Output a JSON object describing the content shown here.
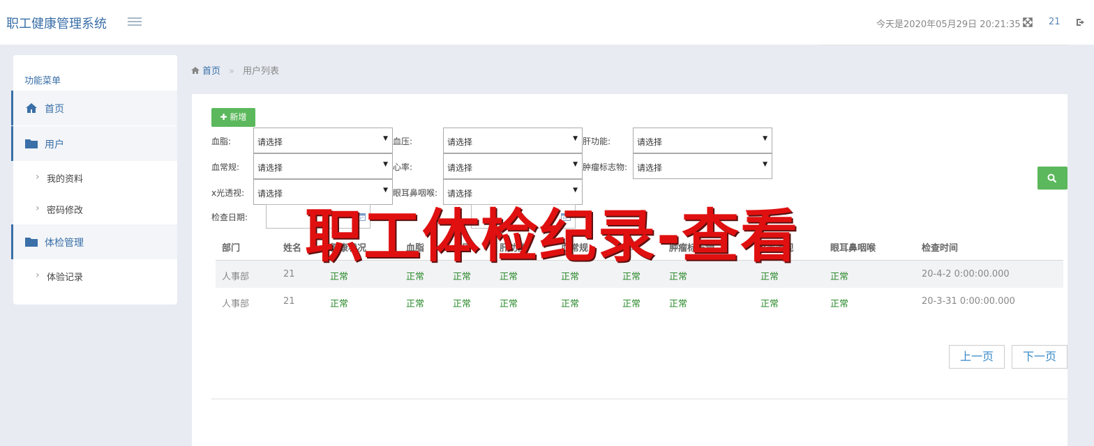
{
  "header": {
    "app_title": "职工健康管理系统",
    "datetime": "今天是2020年05月29日 20:21:35",
    "user": "21"
  },
  "sidebar": {
    "heading": "功能菜单",
    "items": [
      {
        "label": "首页",
        "icon": "home-icon"
      },
      {
        "label": "用户",
        "icon": "folder-icon"
      },
      {
        "label": "我的资料",
        "icon": "chevron-right-icon"
      },
      {
        "label": "密码修改",
        "icon": "chevron-right-icon"
      },
      {
        "label": "体检管理",
        "icon": "folder-icon"
      },
      {
        "label": "体验记录",
        "icon": "chevron-right-icon"
      }
    ]
  },
  "breadcrumb": {
    "home": "首页",
    "separator": "»",
    "current": "用户列表"
  },
  "toolbar": {
    "add_label": "新增"
  },
  "filters": {
    "blood_lipid": {
      "label": "血脂:",
      "value": "请选择"
    },
    "blood_pressure": {
      "label": "血压:",
      "value": "请选择"
    },
    "liver": {
      "label": "肝功能:",
      "value": "请选择"
    },
    "blood_routine": {
      "label": "血常规:",
      "value": "请选择"
    },
    "heart_rate": {
      "label": "心率:",
      "value": "请选择"
    },
    "tumor": {
      "label": "肿瘤标志物:",
      "value": "请选择"
    },
    "xray": {
      "label": "x光透视:",
      "value": "请选择"
    },
    "ent": {
      "label": "眼耳鼻咽喉:",
      "value": "请选择"
    },
    "date": {
      "label": "检查日期:"
    }
  },
  "table": {
    "headers": [
      "部门",
      "姓名",
      "健康状况",
      "血脂",
      "血压",
      "肝功能",
      "血常规",
      "心率",
      "肿瘤标志物",
      "x光透视",
      "眼耳鼻咽喉",
      "检查时间"
    ],
    "rows": [
      [
        "人事部",
        "21",
        "正常",
        "正常",
        "正常",
        "正常",
        "正常",
        "正常",
        "正常",
        "正常",
        "正常",
        "20-4-2 0:00:00.000"
      ],
      [
        "人事部",
        "21",
        "正常",
        "正常",
        "正常",
        "正常",
        "正常",
        "正常",
        "正常",
        "正常",
        "正常",
        "20-3-31 0:00:00.000"
      ]
    ]
  },
  "pagination": {
    "prev": "上一页",
    "next": "下一页"
  },
  "overlay_title": "职工体检纪录-查看",
  "colors": {
    "accent": "#3a6fa8",
    "success": "#5cb85c",
    "normal_text": "#2e8b2e",
    "overlay": "#e01010"
  }
}
